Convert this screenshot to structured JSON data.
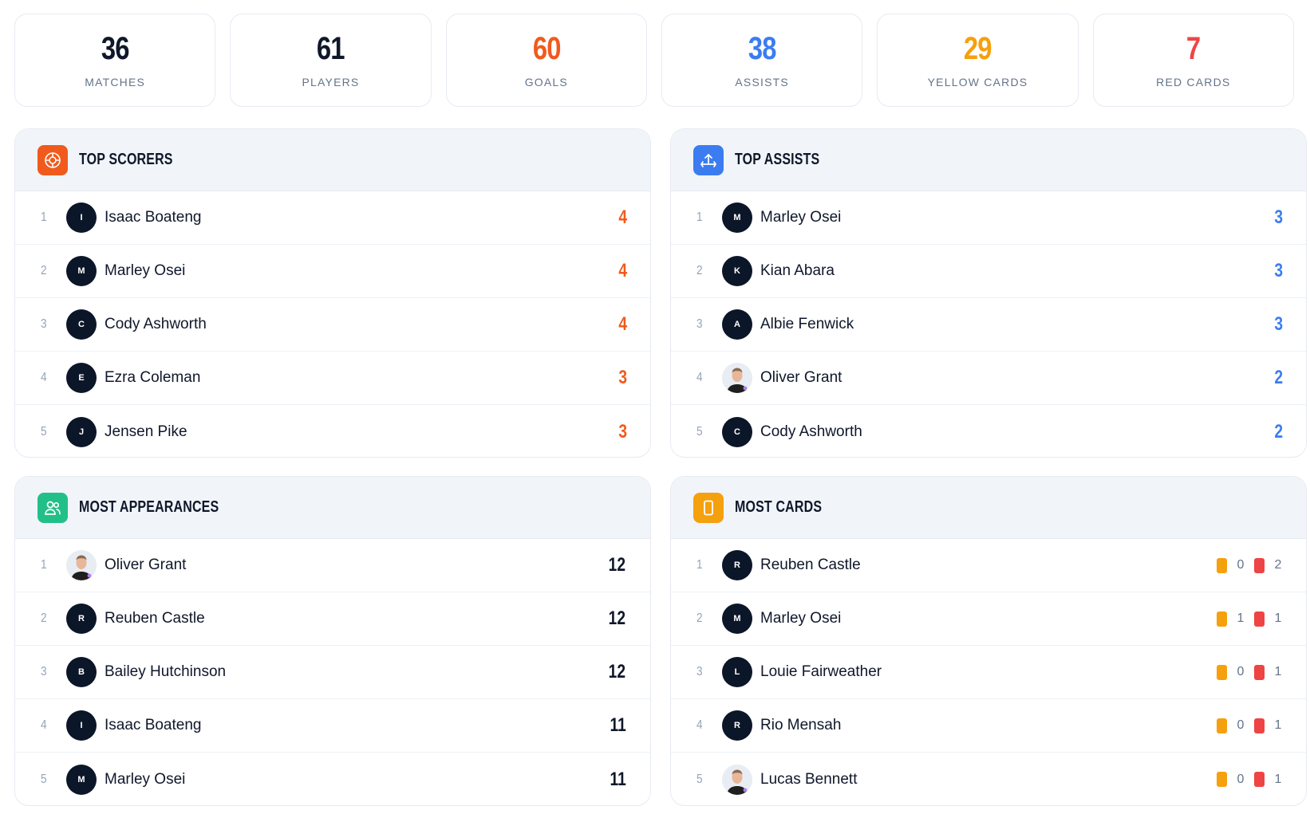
{
  "stats": [
    {
      "value": "36",
      "label": "MATCHES",
      "color": "#0f172a"
    },
    {
      "value": "61",
      "label": "PLAYERS",
      "color": "#0f172a"
    },
    {
      "value": "60",
      "label": "GOALS",
      "color": "#f05a1c"
    },
    {
      "value": "38",
      "label": "ASSISTS",
      "color": "#3b7df0"
    },
    {
      "value": "29",
      "label": "YELLOW CARDS",
      "color": "#f5a00d"
    },
    {
      "value": "7",
      "label": "RED CARDS",
      "color": "#ef4444"
    }
  ],
  "top_scorers": {
    "title": "TOP SCORERS",
    "icon": "target-icon",
    "icon_color": "#f05a1c",
    "rows": [
      {
        "rank": "1",
        "initial": "I",
        "name": "Isaac Boateng",
        "value": "4"
      },
      {
        "rank": "2",
        "initial": "M",
        "name": "Marley Osei",
        "value": "4"
      },
      {
        "rank": "3",
        "initial": "C",
        "name": "Cody Ashworth",
        "value": "4"
      },
      {
        "rank": "4",
        "initial": "E",
        "name": "Ezra Coleman",
        "value": "3"
      },
      {
        "rank": "5",
        "initial": "J",
        "name": "Jensen Pike",
        "value": "3"
      }
    ]
  },
  "top_assists": {
    "title": "TOP ASSISTS",
    "icon": "share-arrow-icon",
    "icon_color": "#3b7df0",
    "rows": [
      {
        "rank": "1",
        "initial": "M",
        "name": "Marley Osei",
        "value": "3"
      },
      {
        "rank": "2",
        "initial": "K",
        "name": "Kian Abara",
        "value": "3"
      },
      {
        "rank": "3",
        "initial": "A",
        "name": "Albie Fenwick",
        "value": "3"
      },
      {
        "rank": "4",
        "initial": "",
        "name": "Oliver Grant",
        "value": "2",
        "photo": true
      },
      {
        "rank": "5",
        "initial": "C",
        "name": "Cody Ashworth",
        "value": "2"
      }
    ]
  },
  "most_appearances": {
    "title": "MOST APPEARANCES",
    "icon": "users-icon",
    "icon_color": "#22c088",
    "rows": [
      {
        "rank": "1",
        "initial": "",
        "name": "Oliver Grant",
        "value": "12",
        "photo": true
      },
      {
        "rank": "2",
        "initial": "R",
        "name": "Reuben Castle",
        "value": "12"
      },
      {
        "rank": "3",
        "initial": "B",
        "name": "Bailey Hutchinson",
        "value": "12"
      },
      {
        "rank": "4",
        "initial": "I",
        "name": "Isaac Boateng",
        "value": "11"
      },
      {
        "rank": "5",
        "initial": "M",
        "name": "Marley Osei",
        "value": "11"
      }
    ]
  },
  "most_cards": {
    "title": "MOST CARDS",
    "icon": "card-icon",
    "icon_color": "#f5a00d",
    "rows": [
      {
        "rank": "1",
        "initial": "R",
        "name": "Reuben Castle",
        "yellow": "0",
        "red": "2"
      },
      {
        "rank": "2",
        "initial": "M",
        "name": "Marley Osei",
        "yellow": "1",
        "red": "1"
      },
      {
        "rank": "3",
        "initial": "L",
        "name": "Louie Fairweather",
        "yellow": "0",
        "red": "1"
      },
      {
        "rank": "4",
        "initial": "R",
        "name": "Rio Mensah",
        "yellow": "0",
        "red": "1"
      },
      {
        "rank": "5",
        "initial": "",
        "name": "Lucas Bennett",
        "yellow": "0",
        "red": "1",
        "photo": true
      }
    ]
  }
}
